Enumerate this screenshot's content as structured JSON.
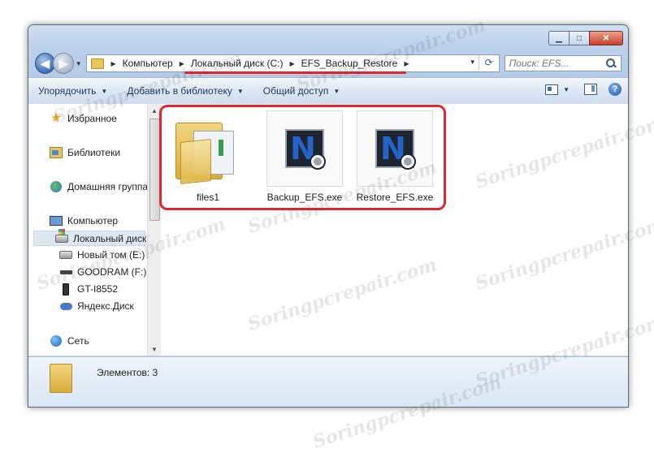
{
  "window": {
    "controls": {
      "minimize": "▁",
      "maximize": "□",
      "close": "✕"
    }
  },
  "nav": {
    "back_glyph": "◀",
    "forward_glyph": "▶",
    "breadcrumbs": [
      "Компьютер",
      "Локальный диск (C:)",
      "EFS_Backup_Restore"
    ],
    "search_placeholder": "Поиск: EFS..."
  },
  "toolbar": {
    "organize": "Упорядочить",
    "add_to_library": "Добавить в библиотеку",
    "share": "Общий доступ",
    "help": "?"
  },
  "sidebar": {
    "favorites": "Избранное",
    "libraries": "Библиотеки",
    "homegroup": "Домашняя группа",
    "computer": "Компьютер",
    "drives": [
      "Локальный диск",
      "Новый том (E:)",
      "GOODRAM (F:)",
      "GT-I8552",
      "Яндекс.Диск"
    ],
    "network": "Сеть"
  },
  "files": [
    {
      "name": "files1",
      "icon": "folder-icon"
    },
    {
      "name": "Backup_EFS.exe",
      "icon": "exe-icon"
    },
    {
      "name": "Restore_EFS.exe",
      "icon": "exe-icon"
    }
  ],
  "status": {
    "count": "Элементов: 3"
  },
  "watermark": "Soringpcrepair.com",
  "colors": {
    "highlight": "#e3262c",
    "chrome": "#bcd1ea",
    "selection": "#dde8f3"
  }
}
